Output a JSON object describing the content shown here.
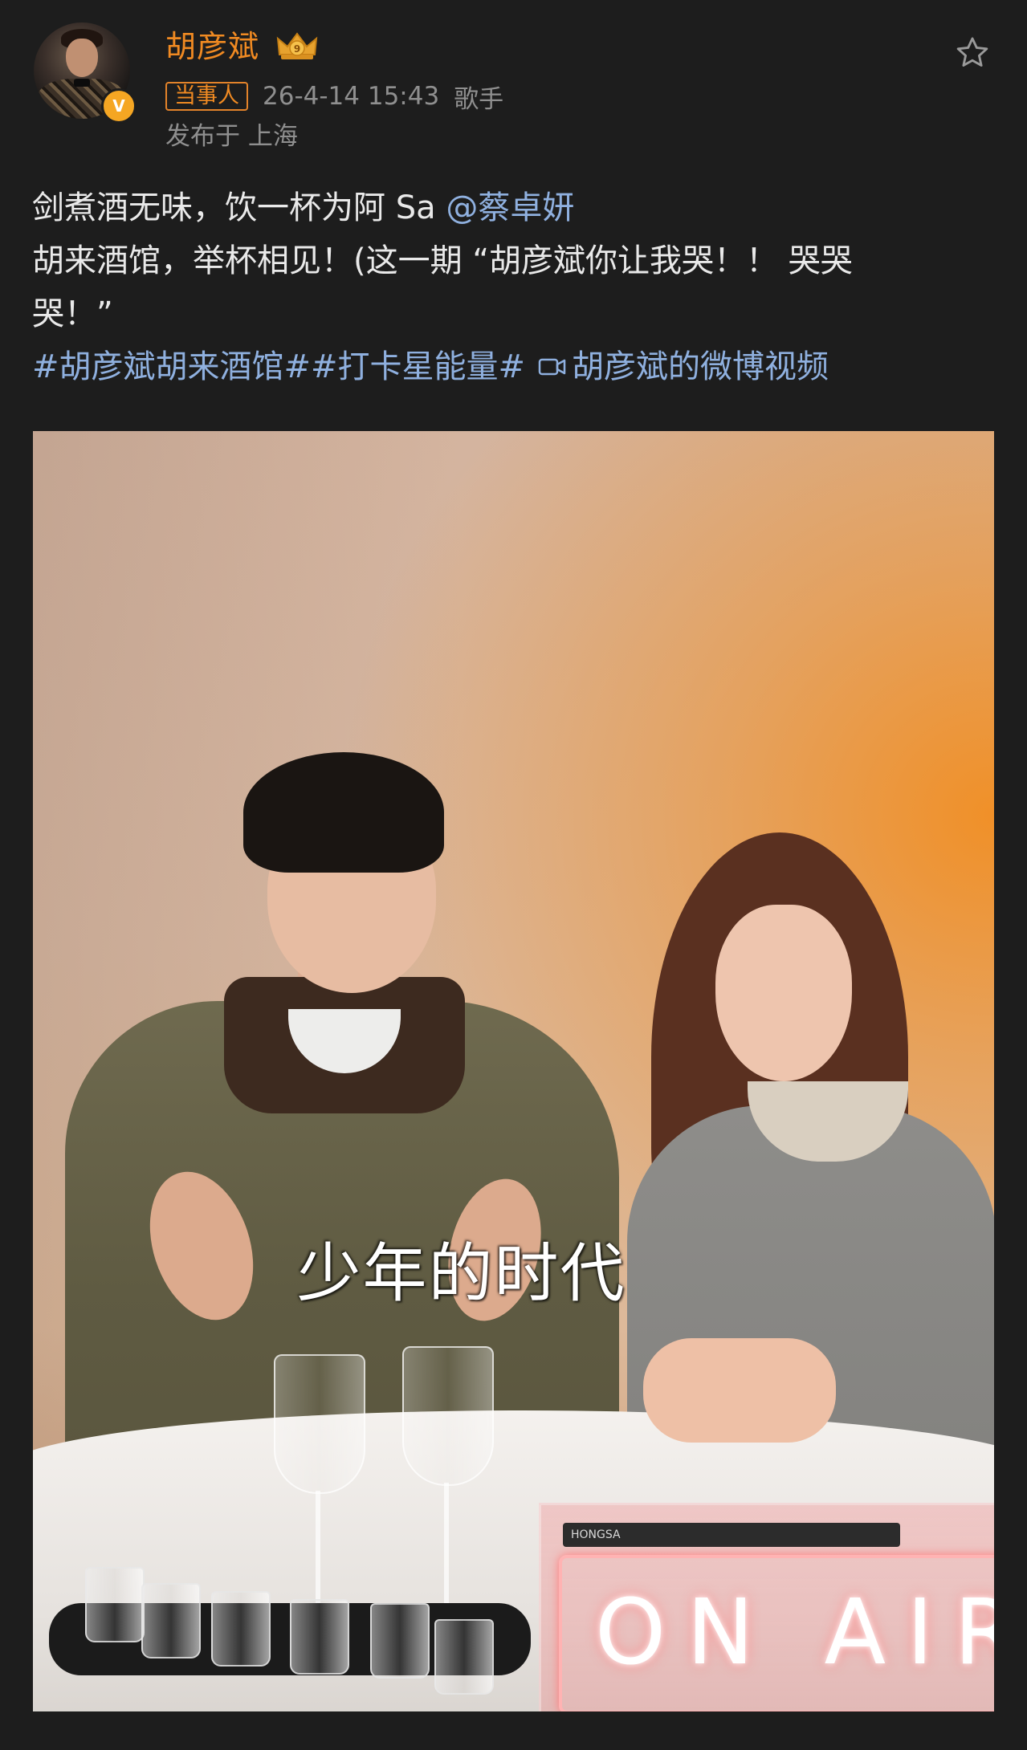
{
  "post": {
    "author": {
      "name": "胡彦斌",
      "verified_badge_letter": "V",
      "tag": "当事人",
      "timestamp": "26-4-14 15:43",
      "title": "歌手",
      "location": "发布于 上海"
    },
    "text": {
      "line1_prefix": "剑煮酒无味，饮一杯为阿 Sa ",
      "mention": "@蔡卓妍",
      "line2": "胡来酒馆，举杯相见！(这一期 “胡彦斌你让我哭！！ 哭哭",
      "line3": "哭！”"
    },
    "topics": {
      "topic1": "#胡彦斌胡来酒馆#",
      "topic2": "#打卡星能量#",
      "video_link": "胡彦斌的微博视频"
    },
    "video": {
      "subtitle": "少年的时代",
      "neon_sign": "ON AIR",
      "device_label": "HONGSA"
    }
  },
  "icons": {
    "favorite": "star-outline-icon",
    "video_link": "video-camera-icon",
    "crown": "crown-badge-icon",
    "verified": "verified-icon"
  },
  "colors": {
    "background": "#1d1d1d",
    "username": "#f08a22",
    "link": "#8fb0df",
    "meta": "#8f8f8f",
    "verified": "#f5a623"
  }
}
